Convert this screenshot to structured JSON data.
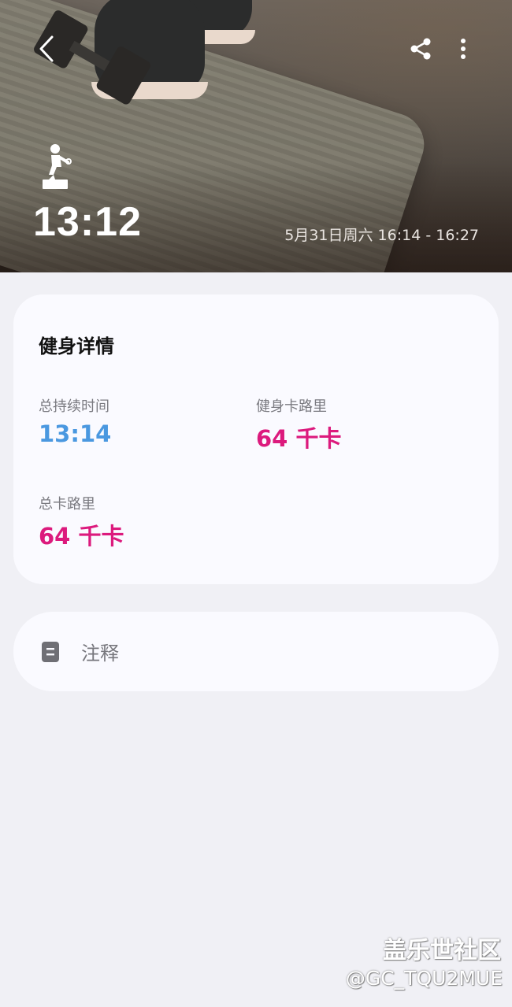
{
  "header": {
    "duration": "13:12",
    "datetime": "5月31日周六 16:14 - 16:27",
    "icons": {
      "back": "back-arrow-icon",
      "share": "share-icon",
      "more": "more-vertical-icon",
      "workout": "workout-figure-icon"
    }
  },
  "details": {
    "title": "健身详情",
    "total_duration": {
      "label": "总持续时间",
      "value": "13:14",
      "color": "#4a98e0"
    },
    "workout_calories": {
      "label": "健身卡路里",
      "value": "64 千卡",
      "color": "#dc1a7d"
    },
    "total_calories": {
      "label": "总卡路里",
      "value": "64 千卡",
      "color": "#dc1a7d"
    }
  },
  "notes": {
    "label": "注释",
    "icon": "note-icon"
  },
  "watermark": {
    "line1": "盖乐世社区",
    "line2": "@GC_TQU2MUE"
  }
}
